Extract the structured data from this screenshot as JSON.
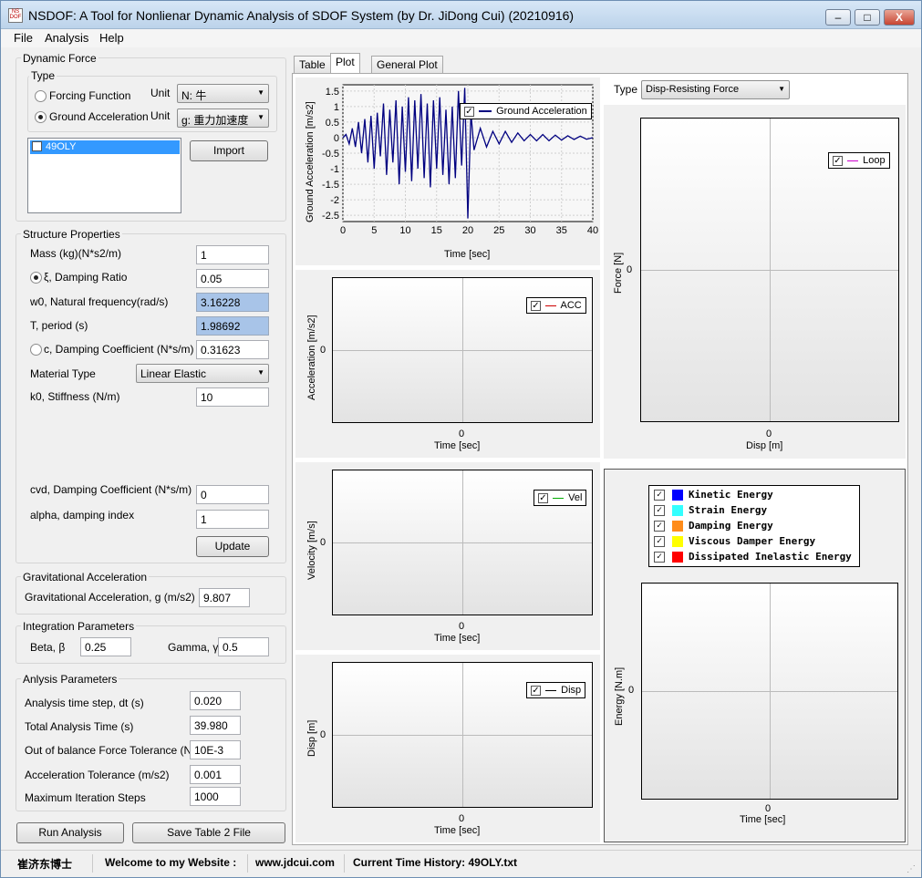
{
  "window": {
    "title": "NSDOF: A Tool for Nonlienar Dynamic Analysis of SDOF System (by Dr. JiDong Cui) (20210916)",
    "minimize": "–",
    "maximize": "□",
    "close": "X"
  },
  "menu": {
    "file": "File",
    "analysis": "Analysis",
    "help": "Help"
  },
  "dynamic_force": {
    "group_title": "Dynamic Force",
    "type_title": "Type",
    "forcing_function": "Forcing Function",
    "ground_acceleration": "Ground Acceleration",
    "unit_label": "Unit",
    "force_unit": "N: 牛",
    "accel_unit": "g: 重力加速度",
    "list_item": "49OLY",
    "import_button": "Import"
  },
  "structure": {
    "group_title": "Structure Properties",
    "mass_label": "Mass (kg)(N*s2/m)",
    "mass_value": "1",
    "damping_ratio_label": "ξ, Damping Ratio",
    "damping_ratio_value": "0.05",
    "w0_label": "w0, Natural frequency(rad/s)",
    "w0_value": "3.16228",
    "period_label": "T, period (s)",
    "period_value": "1.98692",
    "damping_coef_label": "c, Damping Coefficient (N*s/m)",
    "damping_coef_value": "0.31623",
    "material_label": "Material Type",
    "material_value": "Linear Elastic",
    "k0_label": "k0, Stiffness (N/m)",
    "k0_value": "10",
    "cvd_label": "cvd, Damping Coefficient (N*s/m)",
    "cvd_value": "0",
    "alpha_label": "alpha, damping index",
    "alpha_value": "1",
    "update_button": "Update"
  },
  "gravity": {
    "group_title": "Gravitational Acceleration",
    "label": "Gravitational Acceleration, g (m/s2)",
    "value": "9.807"
  },
  "integration": {
    "group_title": "Integration Parameters",
    "beta_label": "Beta, β",
    "beta_value": "0.25",
    "gamma_label": "Gamma, γ",
    "gamma_value": "0.5"
  },
  "analysis": {
    "group_title": "Anlysis  Parameters",
    "dt_label": "Analysis time step, dt (s)",
    "dt_value": "0.020",
    "total_label": "Total Analysis Time (s)",
    "total_value": "39.980",
    "force_tol_label": "Out of balance Force Tolerance (N)",
    "force_tol_value": "10E-3",
    "acc_tol_label": "Acceleration Tolerance (m/s2)",
    "acc_tol_value": "0.001",
    "max_iter_label": "Maximum Iteration Steps",
    "max_iter_value": "1000"
  },
  "buttons": {
    "run": "Run Analysis",
    "save": "Save Table 2 File"
  },
  "tabs": {
    "table": "Table",
    "plot": "Plot",
    "general": "General Plot"
  },
  "plots": {
    "ground": {
      "ylabel": "Ground Acceleration [m/s2]",
      "xlabel": "Time [sec]",
      "legend": "Ground Acceleration"
    },
    "acc": {
      "ylabel": "Acceleration [m/s2]",
      "xlabel": "Time [sec]",
      "legend": "ACC",
      "zero": "0"
    },
    "vel": {
      "ylabel": "Velocity [m/s]",
      "xlabel": "Time [sec]",
      "legend": "Vel",
      "zero": "0"
    },
    "disp": {
      "ylabel": "Disp [m]",
      "xlabel": "Time [sec]",
      "legend": "Disp",
      "zero": "0"
    },
    "loop": {
      "type_label": "Type",
      "type_value": "Disp-Resisting Force",
      "ylabel": "Force [N]",
      "xlabel": "Disp [m]",
      "legend": "Loop",
      "zero": "0"
    },
    "energy": {
      "ylabel": "Energy [N.m]",
      "xlabel": "Time [sec]",
      "zero": "0",
      "legend": [
        {
          "label": "Kinetic Energy",
          "color": "#0000ff"
        },
        {
          "label": "Strain Energy",
          "color": "#33ffff"
        },
        {
          "label": "Damping Energy",
          "color": "#ff8c1a"
        },
        {
          "label": "Viscous Damper Energy",
          "color": "#ffff00"
        },
        {
          "label": "Dissipated Inelastic Energy",
          "color": "#ff0000"
        }
      ]
    }
  },
  "chart_data": {
    "type": "line",
    "ylabel": "Ground Acceleration [m/s2]",
    "xlabel": "Time [sec]",
    "xlim": [
      0,
      40
    ],
    "ylim": [
      -2.7,
      1.7
    ],
    "xticks": [
      "0",
      "5",
      "10",
      "15",
      "20",
      "25",
      "30",
      "35",
      "40"
    ],
    "yticks": [
      "1.5",
      "1",
      "0.5",
      "0",
      "-0.5",
      "-1",
      "-1.5",
      "-2",
      "-2.5"
    ],
    "series": [
      {
        "name": "Ground Acceleration",
        "color": "#000080",
        "x": [
          0,
          0.5,
          1,
          1.5,
          2,
          2.5,
          3,
          3.5,
          4,
          4.5,
          5,
          5.5,
          6,
          6.5,
          7,
          7.5,
          8,
          8.5,
          9,
          9.5,
          10,
          10.5,
          11,
          11.5,
          12,
          12.5,
          13,
          13.5,
          14,
          14.5,
          15,
          15.5,
          16,
          16.5,
          17,
          17.5,
          18,
          18.5,
          19,
          19.5,
          20,
          20.5,
          21,
          22,
          23,
          24,
          25,
          26,
          27,
          28,
          29,
          30,
          31,
          32,
          33,
          34,
          35,
          36,
          37,
          38,
          39,
          40
        ],
        "y": [
          0,
          0.1,
          -0.2,
          0.3,
          -0.3,
          0.5,
          -0.5,
          0.6,
          -0.8,
          0.7,
          -1.0,
          0.8,
          -0.6,
          1.1,
          -1.2,
          0.9,
          -0.8,
          1.2,
          -1.5,
          1.0,
          -1.1,
          1.3,
          -1.4,
          1.2,
          -1.0,
          1.4,
          -1.3,
          1.1,
          -1.6,
          1.2,
          -1.0,
          1.3,
          -1.2,
          0.9,
          -1.5,
          1.0,
          -1.3,
          1.5,
          -0.9,
          1.6,
          -2.6,
          0.8,
          -0.4,
          0.3,
          -0.3,
          0.2,
          -0.2,
          0.2,
          -0.15,
          0.15,
          -0.1,
          0.1,
          -0.1,
          0.1,
          -0.1,
          0.08,
          -0.08,
          0.06,
          -0.06,
          0.05,
          -0.05,
          0
        ]
      }
    ]
  },
  "status": {
    "name": "崔济东博士",
    "welcome": "Welcome to my Website :",
    "site": "www.jdcui.com",
    "current": "Current Time History: 49OLY.txt"
  }
}
